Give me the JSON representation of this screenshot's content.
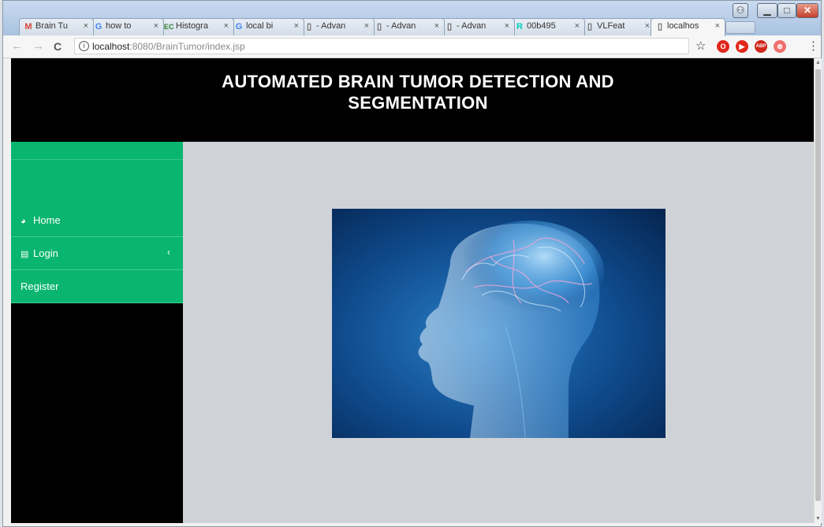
{
  "browser": {
    "tabs": [
      {
        "label": "Brain Tu",
        "icon": "gmail-icon",
        "icon_text": "M",
        "icon_color": "#d44638"
      },
      {
        "label": "how to",
        "icon": "google-icon",
        "icon_text": "G",
        "icon_color": "#4285f4"
      },
      {
        "label": "Histogra",
        "icon": "ec-icon",
        "icon_text": "EC",
        "icon_color": "#2e7d32"
      },
      {
        "label": "local bi",
        "icon": "google-icon",
        "icon_text": "G",
        "icon_color": "#4285f4"
      },
      {
        "label": "- Advan",
        "icon": "page-icon",
        "icon_text": "▯",
        "icon_color": "#666666"
      },
      {
        "label": "- Advan",
        "icon": "page-icon",
        "icon_text": "▯",
        "icon_color": "#666666"
      },
      {
        "label": "- Advan",
        "icon": "page-icon",
        "icon_text": "▯",
        "icon_color": "#666666"
      },
      {
        "label": "00b495",
        "icon": "researchgate-icon",
        "icon_text": "R",
        "icon_color": "#00ccbb"
      },
      {
        "label": "VLFeat",
        "icon": "page-icon",
        "icon_text": "▯",
        "icon_color": "#666666"
      },
      {
        "label": "localhos",
        "icon": "page-icon",
        "icon_text": "▯",
        "icon_color": "#666666",
        "active": true
      }
    ],
    "tab_close": "×",
    "url_host": "localhost",
    "url_path": ":8080/BrainTumor/index.jsp",
    "info_glyph": "i",
    "back_glyph": "←",
    "forward_glyph": "→",
    "reload_glyph": "C",
    "star_glyph": "☆",
    "extensions": [
      {
        "name": "opera-icon",
        "text": "O",
        "color": "#e0271a"
      },
      {
        "name": "video-icon",
        "text": "▶",
        "color": "#e0271a"
      },
      {
        "name": "abp-icon",
        "text": "ABP",
        "color": "#d0271a"
      },
      {
        "name": "blocker-icon",
        "text": "⊗",
        "color": "#f07070"
      }
    ],
    "menu_glyph": "⋮",
    "window_controls": {
      "user": "⚇",
      "minimize": "▁",
      "maximize": "□",
      "close": "✕"
    }
  },
  "page": {
    "title_line1": "AUTOMATED BRAIN TUMOR DETECTION AND",
    "title_line2": "SEGMENTATION",
    "menu": [
      {
        "label": "Home",
        "icon": "dashboard-icon",
        "glyph": "◕"
      },
      {
        "label": "Login",
        "icon": "card-icon",
        "glyph": "▤",
        "chevron": "‹"
      },
      {
        "label": "Register"
      }
    ],
    "colors": {
      "header": "#000000",
      "sidebar_green": "#0ab56f",
      "content_bg": "#cfd3d8"
    }
  }
}
